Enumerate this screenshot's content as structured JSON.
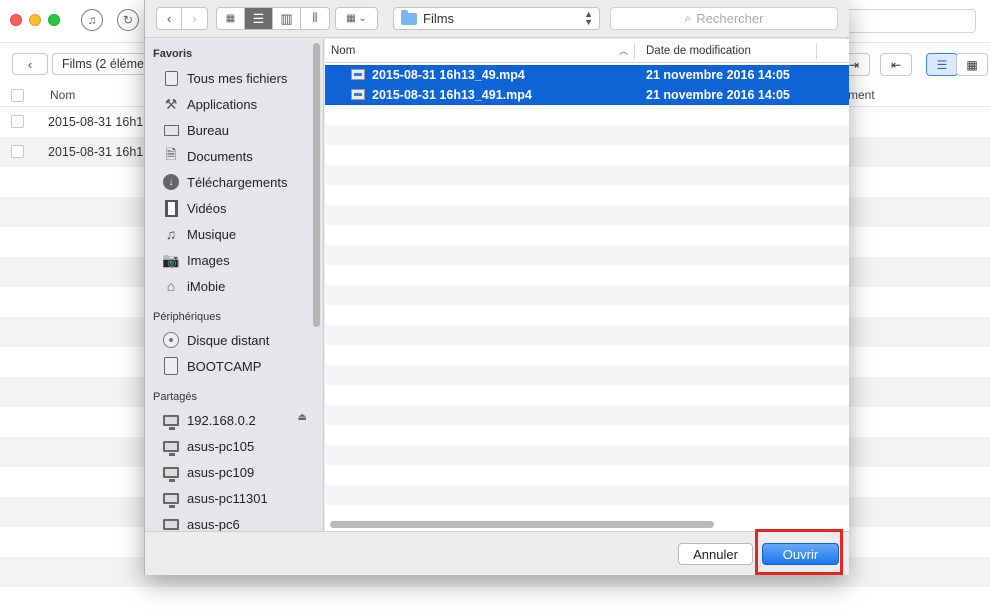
{
  "background_app": {
    "breadcrumb": "Films (2 éléme",
    "header": {
      "col_name": "Nom",
      "col_right": "ment"
    },
    "rows": [
      "2015-08-31 16h13",
      "2015-08-31 16h13"
    ]
  },
  "dialog": {
    "location": "Films",
    "search_placeholder": "Rechercher",
    "sidebar": {
      "favorites_title": "Favoris",
      "favorites": [
        {
          "label": "Tous mes fichiers",
          "icon": "all-files-icon"
        },
        {
          "label": "Applications",
          "icon": "applications-icon"
        },
        {
          "label": "Bureau",
          "icon": "desktop-icon"
        },
        {
          "label": "Documents",
          "icon": "documents-icon"
        },
        {
          "label": "Téléchargements",
          "icon": "downloads-icon"
        },
        {
          "label": "Vidéos",
          "icon": "movies-icon"
        },
        {
          "label": "Musique",
          "icon": "music-icon"
        },
        {
          "label": "Images",
          "icon": "camera-icon"
        },
        {
          "label": "iMobie",
          "icon": "home-icon"
        }
      ],
      "devices_title": "Périphériques",
      "devices": [
        {
          "label": "Disque distant",
          "icon": "remote-disc-icon"
        },
        {
          "label": "BOOTCAMP",
          "icon": "disk-icon"
        }
      ],
      "shared_title": "Partagés",
      "shared": [
        {
          "label": "192.168.0.2",
          "icon": "network-computer-icon"
        },
        {
          "label": "asus-pc105",
          "icon": "network-computer-icon"
        },
        {
          "label": "asus-pc109",
          "icon": "network-computer-icon"
        },
        {
          "label": "asus-pc11301",
          "icon": "network-computer-icon"
        },
        {
          "label": "asus-pc6",
          "icon": "network-computer-icon"
        }
      ]
    },
    "file_list": {
      "col_name": "Nom",
      "col_date": "Date de modification",
      "files": [
        {
          "name": "2015-08-31 16h13_49.mp4",
          "date": "21 novembre 2016 14:05",
          "selected": true
        },
        {
          "name": "2015-08-31 16h13_491.mp4",
          "date": "21 novembre 2016 14:05",
          "selected": true
        }
      ]
    },
    "buttons": {
      "cancel": "Annuler",
      "open": "Ouvrir"
    }
  },
  "colors": {
    "selection": "#0e63d7",
    "primary_button": "#1a77ea",
    "highlight_box": "#e5261f"
  }
}
